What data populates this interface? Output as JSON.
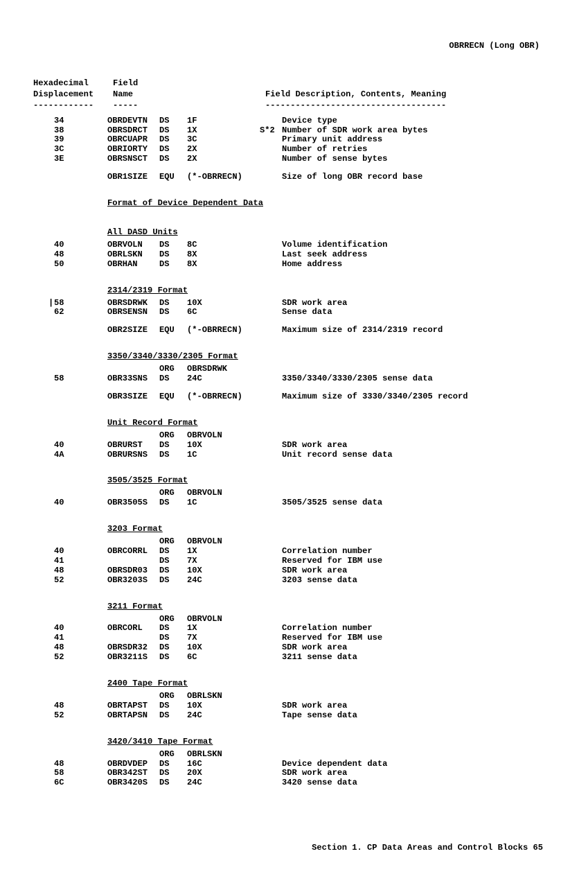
{
  "header": "OBRRECN (Long OBR)",
  "colHeaders": {
    "dispLine1": "Hexadecimal",
    "dispLine2": "Displacement",
    "dispRule": "------------",
    "nameLine1": "Field",
    "nameLine2": "Name",
    "nameRule": "-----",
    "descLine2": "Field Description, Contents, Meaning",
    "descRule": "------------------------------------"
  },
  "block1": [
    {
      "disp": "34",
      "name": "OBRDEVTN",
      "op": "DS",
      "len": "1F",
      "flag": "",
      "desc": "Device type"
    },
    {
      "disp": "38",
      "name": "OBRSDRCT",
      "op": "DS",
      "len": "1X",
      "flag": "S*2",
      "desc": "Number of SDR work area bytes"
    },
    {
      "disp": "39",
      "name": "OBRCUAPR",
      "op": "DS",
      "len": "3C",
      "flag": "",
      "desc": "Primary unit address"
    },
    {
      "disp": "3C",
      "name": "OBRIORTY",
      "op": "DS",
      "len": "2X",
      "flag": "",
      "desc": "Number of retries"
    },
    {
      "disp": "3E",
      "name": "OBRSNSCT",
      "op": "DS",
      "len": "2X",
      "flag": "",
      "desc": "Number of sense bytes"
    }
  ],
  "obr1size": {
    "disp": "",
    "name": "OBR1SIZE",
    "op": "EQU",
    "len": "(*-OBRRECN)",
    "flag": "",
    "desc": "Size of long OBR record base"
  },
  "secDevDep": "Format of Device Dependent Data",
  "secAllDasd": "All DASD Units",
  "allDasd": [
    {
      "disp": "40",
      "name": "OBRVOLN",
      "op": "DS",
      "len": "8C",
      "flag": "",
      "desc": "Volume identification"
    },
    {
      "disp": "48",
      "name": "OBRLSKN",
      "op": "DS",
      "len": "8X",
      "flag": "",
      "desc": "Last seek address"
    },
    {
      "disp": "50",
      "name": "OBRHAN",
      "op": "DS",
      "len": "8X",
      "flag": "",
      "desc": "Home address"
    }
  ],
  "sec2314": "2314/2319 Format",
  "f2314": [
    {
      "disp": "58",
      "name": "OBRSDRWK",
      "op": "DS",
      "len": "10X",
      "flag": "",
      "desc": "SDR work area"
    },
    {
      "disp": "62",
      "name": "OBRSENSN",
      "op": "DS",
      "len": "6C",
      "flag": "",
      "desc": "Sense data"
    }
  ],
  "obr2size": {
    "disp": "",
    "name": "OBR2SIZE",
    "op": "EQU",
    "len": "(*-OBRRECN)",
    "flag": "",
    "desc": "Maximum size of 2314/2319 record"
  },
  "sec3350": "3350/3340/3330/2305 Format",
  "org3350": {
    "op": "ORG",
    "val": "OBRSDRWK"
  },
  "f3350": [
    {
      "disp": "58",
      "name": "OBR33SNS",
      "op": "DS",
      "len": "24C",
      "flag": "",
      "desc": "3350/3340/3330/2305 sense data"
    }
  ],
  "obr3size": {
    "disp": "",
    "name": "OBR3SIZE",
    "op": "EQU",
    "len": "(*-OBRRECN)",
    "flag": "",
    "desc": "Maximum size of 3330/3340/2305 record"
  },
  "secUnitRec": "Unit Record Format",
  "orgUnitRec": {
    "op": "ORG",
    "val": "OBRVOLN"
  },
  "unitRec": [
    {
      "disp": "40",
      "name": "OBRURST",
      "op": "DS",
      "len": "10X",
      "flag": "",
      "desc": "SDR work area"
    },
    {
      "disp": "4A",
      "name": "OBRURSNS",
      "op": "DS",
      "len": "1C",
      "flag": "",
      "desc": "Unit record sense data"
    }
  ],
  "sec3505": "3505/3525 Format",
  "org3505": {
    "op": "ORG",
    "val": "OBRVOLN"
  },
  "f3505": [
    {
      "disp": "40",
      "name": "OBR3505S",
      "op": "DS",
      "len": "1C",
      "flag": "",
      "desc": "3505/3525 sense data"
    }
  ],
  "sec3203": "3203 Format",
  "org3203": {
    "op": "ORG",
    "val": "OBRVOLN"
  },
  "f3203": [
    {
      "disp": "40",
      "name": "OBRCORRL",
      "op": "DS",
      "len": "1X",
      "flag": "",
      "desc": "Correlation number"
    },
    {
      "disp": "41",
      "name": "",
      "op": "DS",
      "len": "7X",
      "flag": "",
      "desc": "Reserved for IBM use"
    },
    {
      "disp": "48",
      "name": "OBRSDR03",
      "op": "DS",
      "len": "10X",
      "flag": "",
      "desc": "SDR work area"
    },
    {
      "disp": "52",
      "name": "OBR3203S",
      "op": "DS",
      "len": "24C",
      "flag": "",
      "desc": "3203 sense data"
    }
  ],
  "sec3211": "3211 Format",
  "org3211": {
    "op": "ORG",
    "val": "OBRVOLN"
  },
  "f3211": [
    {
      "disp": "40",
      "name": "OBRCORL",
      "op": "DS",
      "len": "1X",
      "flag": "",
      "desc": "Correlation number"
    },
    {
      "disp": "41",
      "name": "",
      "op": "DS",
      "len": "7X",
      "flag": "",
      "desc": "Reserved for IBM use"
    },
    {
      "disp": "48",
      "name": "OBRSDR32",
      "op": "DS",
      "len": "10X",
      "flag": "",
      "desc": "SDR work area"
    },
    {
      "disp": "52",
      "name": "OBR3211S",
      "op": "DS",
      "len": "6C",
      "flag": "",
      "desc": "3211 sense data"
    }
  ],
  "sec2400": "2400 Tape Format",
  "org2400": {
    "op": "ORG",
    "val": "OBRLSKN"
  },
  "f2400": [
    {
      "disp": "48",
      "name": "OBRTAPST",
      "op": "DS",
      "len": "10X",
      "flag": "",
      "desc": "SDR work area"
    },
    {
      "disp": "52",
      "name": "OBRTAPSN",
      "op": "DS",
      "len": "24C",
      "flag": "",
      "desc": "Tape sense data"
    }
  ],
  "sec3420": "3420/3410 Tape Format",
  "org3420": {
    "op": "ORG",
    "val": "OBRLSKN"
  },
  "f3420": [
    {
      "disp": "48",
      "name": "OBRDVDEP",
      "op": "DS",
      "len": "16C",
      "flag": "",
      "desc": "Device dependent data"
    },
    {
      "disp": "58",
      "name": "OBR342ST",
      "op": "DS",
      "len": "20X",
      "flag": "",
      "desc": "SDR work area"
    },
    {
      "disp": "6C",
      "name": "OBR3420S",
      "op": "DS",
      "len": "24C",
      "flag": "",
      "desc": "3420 sense data"
    }
  ],
  "footer": "Section 1. CP Data Areas and Control Blocks  65"
}
